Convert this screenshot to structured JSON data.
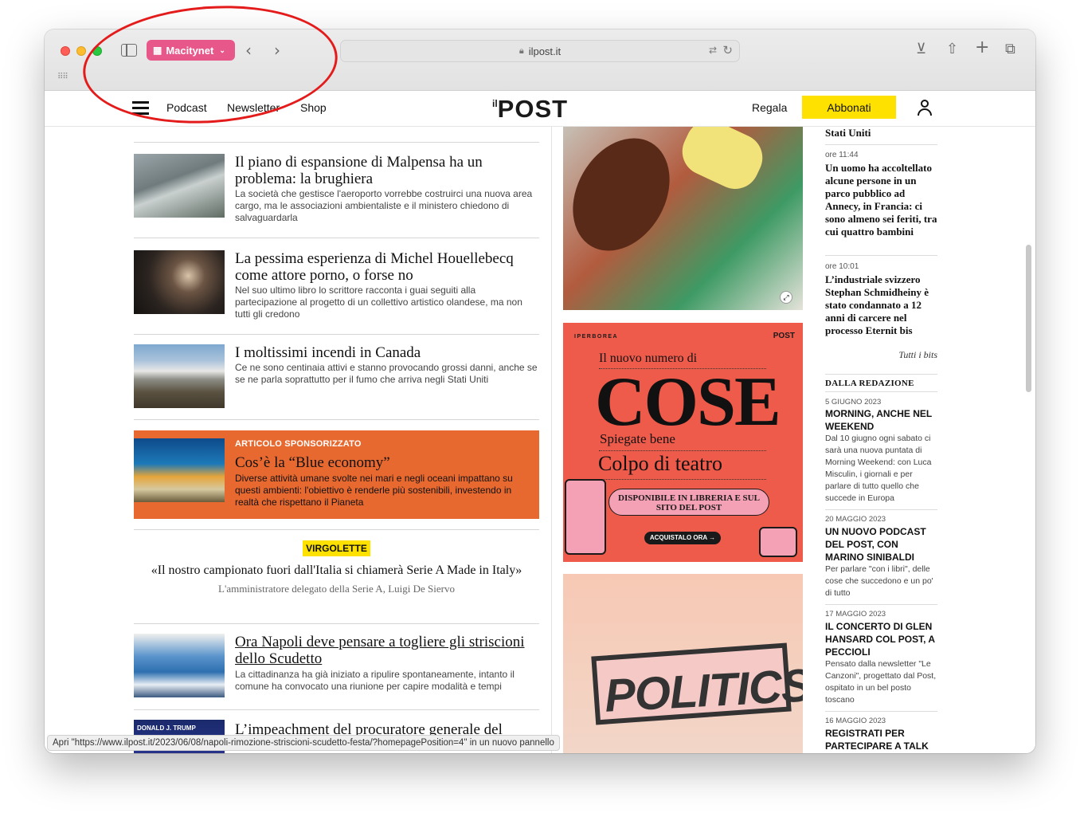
{
  "browser": {
    "profile_label": "Macitynet",
    "url": "ilpost.it",
    "status_text": "Apri \"https://www.ilpost.it/2023/06/08/napoli-rimozione-striscioni-scudetto-festa/?homepagePosition=4\" in un nuovo pannello"
  },
  "site_header": {
    "nav": [
      "Podcast",
      "Newsletter",
      "Shop"
    ],
    "logo_prefix": "il",
    "logo_text": "POST",
    "regala": "Regala",
    "abbonati": "Abbonati"
  },
  "articles": [
    {
      "title": "Il piano di espansione di Malpensa ha un problema: la brughiera",
      "desc": "La società che gestisce l'aeroporto vorrebbe costruirci una nuova area cargo, ma le associazioni ambientaliste e il ministero chiedono di salvaguardarla"
    },
    {
      "title": "La pessima esperienza di Michel Houellebecq come attore porno, o forse no",
      "desc": "Nel suo ultimo libro lo scrittore racconta i guai seguiti alla partecipazione al progetto di un collettivo artistico olandese, ma non tutti gli credono"
    },
    {
      "title": "I moltissimi incendi in Canada",
      "desc": "Ce ne sono centinaia attivi e stanno provocando grossi danni, anche se se ne parla soprattutto per il fumo che arriva negli Stati Uniti"
    }
  ],
  "sponsored": {
    "label": "ARTICOLO SPONSORIZZATO",
    "title": "Cos’è la “Blue economy”",
    "desc": "Diverse attività umane svolte nei mari e negli oceani impattano su questi ambienti: l'obiettivo è renderle più sostenibili, investendo in realtà che rispettano il Pianeta"
  },
  "quote": {
    "label": "VIRGOLETTE",
    "text": "«Il nostro campionato fuori dall'Italia si chiamerà Serie A Made in Italy»",
    "author": "L'amministratore delegato della Serie A, Luigi De Siervo"
  },
  "article_napoli": {
    "title": "Ora Napoli deve pensare a togliere gli striscioni dello Scudetto",
    "desc": "La cittadinanza ha già iniziato a ripulire spontaneamente, intanto il comune ha convocato una riunione per capire modalità e tempi"
  },
  "article_partial": {
    "title": "L’impeachment del procuratore generale del",
    "thumb_text": "DONALD J. TRUMP"
  },
  "ads": {
    "cose": {
      "brand": "IPERBOREA",
      "brand_right": "POST",
      "line1": "Il nuovo numero di",
      "big": "COSE",
      "sub1": "Spiegate bene",
      "sub2": "Colpo di teatro",
      "pill": "DISPONIBILE IN LIBRERIA E SUL SITO DEL POST",
      "cta": "ACQUISTALO ORA"
    },
    "politics": "POLITICS"
  },
  "bits": {
    "top_title": "Stati Uniti",
    "items": [
      {
        "time": "ore 11:44",
        "title": "Un uomo ha accoltellato alcune persone in un parco pubblico ad Annecy, in Francia: ci sono almeno sei feriti, tra cui quattro bambini"
      },
      {
        "time": "ore 10:01",
        "title": "L’industriale svizzero Stephan Schmidheiny è stato condannato a 12 anni di carcere nel processo Eternit bis"
      }
    ],
    "all_link": "Tutti i bits"
  },
  "redazione": {
    "heading": "DALLA REDAZIONE",
    "items": [
      {
        "date": "5 GIUGNO 2023",
        "title": "MORNING, ANCHE NEL WEEKEND",
        "desc": "Dal 10 giugno ogni sabato ci sarà una nuova puntata di Morning Weekend: con Luca Misculin, i giornali e per parlare di tutto quello che succede in Europa"
      },
      {
        "date": "20 MAGGIO 2023",
        "title": "UN NUOVO PODCAST DEL POST, CON MARINO SINIBALDI",
        "desc": "Per parlare \"con i libri\", delle cose che succedono e un po' di tutto"
      },
      {
        "date": "17 MAGGIO 2023",
        "title": "IL CONCERTO DI GLEN HANSARD COL POST, A PECCIOLI",
        "desc": "Pensato dalla newsletter \"Le Canzoni\", progettato dal Post, ospitato in un bel posto toscano"
      },
      {
        "date": "16 MAGGIO 2023",
        "title": "REGISTRATI PER PARTECIPARE A TALK",
        "desc": ""
      }
    ]
  },
  "colors": {
    "profile": "#e8578a",
    "abbonati": "#ffe100",
    "sponsored": "#e8692f",
    "annotation": "#e41b1b"
  }
}
